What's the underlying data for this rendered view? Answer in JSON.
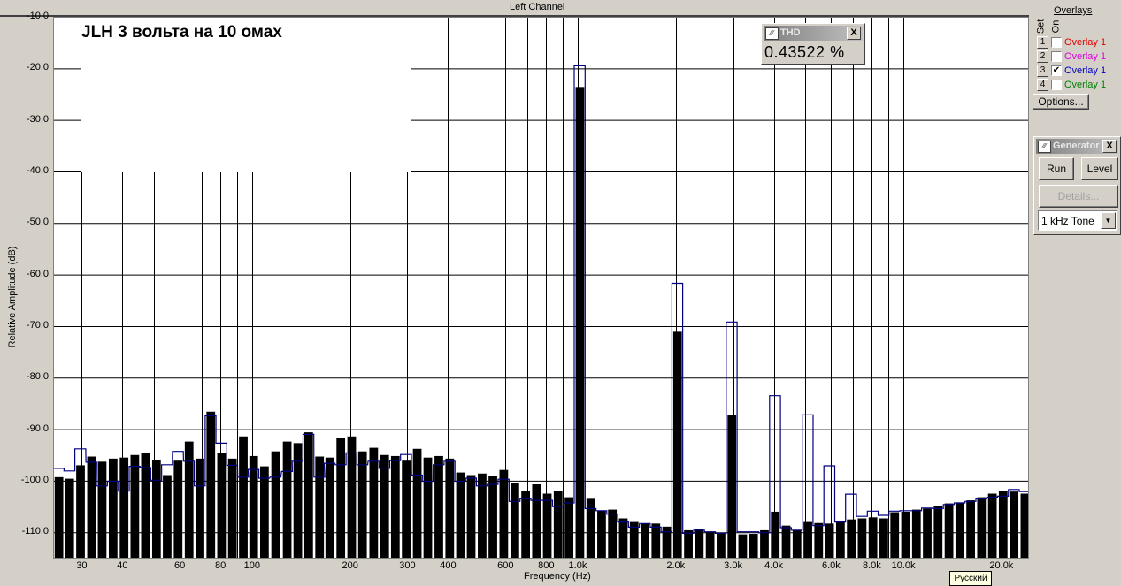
{
  "header": {
    "title": "Left Channel"
  },
  "plot_title": "JLH 3 вольта на  10 омах",
  "thd": {
    "title": "THD",
    "value": "0.43522 %",
    "close": "X"
  },
  "overlays": {
    "title": "Overlays",
    "col_set": "Set",
    "col_on": "On",
    "items": [
      {
        "set": "1",
        "label": "Overlay 1",
        "checked": false,
        "color": "#e00000"
      },
      {
        "set": "2",
        "label": "Overlay 1",
        "checked": false,
        "color": "#e000e0"
      },
      {
        "set": "3",
        "label": "Overlay 1",
        "checked": true,
        "color": "#0000c0"
      },
      {
        "set": "4",
        "label": "Overlay 1",
        "checked": false,
        "color": "#008000"
      }
    ],
    "options_label": "Options..."
  },
  "generator": {
    "title": "Generator",
    "close": "X",
    "run_label": "Run",
    "level_label": "Level",
    "details_label": "Details...",
    "signal": "1 kHz Tone"
  },
  "tooltip": "Русский",
  "chart_data": {
    "type": "bar",
    "title": "JLH 3 вольта на  10 омах",
    "xlabel": "Frequency (Hz)",
    "ylabel": "Relative Amplitude (dB)",
    "x_scale": "log",
    "xlim": [
      24.5,
      24300
    ],
    "ylim": [
      -115.1,
      -10
    ],
    "grid": true,
    "y_ticks": [
      -10,
      -20,
      -30,
      -40,
      -50,
      -60,
      -70,
      -80,
      -90,
      -100,
      -110
    ],
    "y_tick_labels": [
      "-10.0",
      "-20.0",
      "-30.0",
      "-40.0",
      "-50.0",
      "-60.0",
      "-70.0",
      "-80.0",
      "-90.0",
      "-100.0",
      "-110.0"
    ],
    "x_ticks": [
      30,
      40,
      60,
      80,
      100,
      200,
      300,
      400,
      600,
      800,
      1000,
      2000,
      3000,
      4000,
      6000,
      8000,
      10000,
      20000
    ],
    "x_tick_labels": [
      "30",
      "40",
      "60",
      "80",
      "100",
      "200",
      "300",
      "400",
      "600",
      "800",
      "1.0k",
      "2.0k",
      "3.0k",
      "4.0k",
      "6.0k",
      "8.0k",
      "10.0k",
      "20.0k"
    ],
    "x_grid": [
      30,
      40,
      50,
      60,
      70,
      80,
      90,
      100,
      200,
      300,
      400,
      500,
      600,
      700,
      800,
      900,
      1000,
      2000,
      3000,
      4000,
      5000,
      6000,
      7000,
      8000,
      9000,
      10000,
      20000
    ],
    "bar_color": "#000000",
    "overlay_color": "#000080",
    "frequencies": [
      25.5,
      27.5,
      29.7,
      32.1,
      34.6,
      37.4,
      40.4,
      43.6,
      47.0,
      50.8,
      54.8,
      59.2,
      64.0,
      69.1,
      74.6,
      80.5,
      86.9,
      93.9,
      101,
      109,
      118,
      128,
      138,
      149,
      161,
      173,
      187,
      202,
      218,
      236,
      255,
      275,
      297,
      321,
      346,
      374,
      404,
      436,
      470,
      508,
      548,
      592,
      640,
      691,
      746,
      805,
      869,
      939,
      1014,
      1095,
      1182,
      1276,
      1378,
      1488,
      1607,
      1735,
      1873,
      2022,
      2184,
      2358,
      2546,
      2750,
      2969,
      3206,
      3461,
      3738,
      4035,
      4357,
      4705,
      5081,
      5485,
      5923,
      6396,
      6906,
      7457,
      8052,
      8693,
      9389,
      10138,
      10946,
      11819,
      12761,
      13784,
      14880,
      16066,
      17346,
      18728,
      20216,
      21835,
      23575
    ],
    "series": [
      {
        "values": [
          -99.3,
          -99.6,
          -97,
          -95.3,
          -96.3,
          -95.7,
          -95.5,
          -95,
          -94.6,
          -95.9,
          -98.9,
          -96.1,
          -92.4,
          -95.7,
          -86.6,
          -94.6,
          -95.7,
          -91.4,
          -95.2,
          -97.2,
          -94.3,
          -92.4,
          -92.7,
          -90.6,
          -95.3,
          -95.5,
          -91.7,
          -91.4,
          -94.3,
          -93.6,
          -95,
          -95.2,
          -96.1,
          -93.8,
          -95.5,
          -95.2,
          -95.7,
          -98.4,
          -98.9,
          -98.6,
          -99.1,
          -97.9,
          -100.5,
          -102,
          -100.7,
          -102.5,
          -102,
          -103.2,
          -23.6,
          -103.5,
          -105.8,
          -105.6,
          -107.3,
          -108,
          -108.3,
          -108.3,
          -108.9,
          -71.1,
          -109.6,
          -109.4,
          -109.9,
          -110.1,
          -87.2,
          -110.4,
          -110.3,
          -109.6,
          -106,
          -108.7,
          -109.6,
          -108,
          -108.2,
          -108.3,
          -107.8,
          -107.5,
          -107.3,
          -107.1,
          -107.3,
          -106.1,
          -106,
          -105.6,
          -105.4,
          -104.9,
          -104.4,
          -104.2,
          -103.8,
          -103.2,
          -102.5,
          -102,
          -102.1,
          -102.5
        ]
      },
      {
        "overlay": "Overlay 1 (set 3)",
        "values": [
          -97.6,
          -98.1,
          -93.8,
          -96.4,
          -101,
          -100.1,
          -102,
          -97.2,
          -97.4,
          -99.9,
          -96.9,
          -94.3,
          -96.2,
          -101,
          -87.4,
          -92.7,
          -97,
          -99.3,
          -97.8,
          -99.5,
          -99.3,
          -98.2,
          -96.2,
          -91,
          -99.3,
          -96.6,
          -96.9,
          -94.6,
          -96.9,
          -96.2,
          -97.6,
          -96.1,
          -94.9,
          -98.9,
          -100.1,
          -96.9,
          -96.2,
          -100.1,
          -99.5,
          -101,
          -100.7,
          -99.7,
          -104,
          -103.5,
          -103.8,
          -103.8,
          -105,
          -104.3,
          -19.5,
          -105.4,
          -105.8,
          -106.5,
          -108,
          -109,
          -108.3,
          -109,
          -109.9,
          -61.7,
          -110.2,
          -109.6,
          -109.9,
          -110.2,
          -69.2,
          -109.9,
          -109.9,
          -110.1,
          -83.5,
          -109.1,
          -109.6,
          -87.2,
          -108.7,
          -97.1,
          -108,
          -102.6,
          -106.9,
          -105.9,
          -106.7,
          -105.9,
          -105.8,
          -105.8,
          -105.3,
          -105.4,
          -104.6,
          -104.3,
          -104,
          -103.5,
          -103.2,
          -103,
          -101.7,
          -102.1
        ]
      }
    ]
  }
}
